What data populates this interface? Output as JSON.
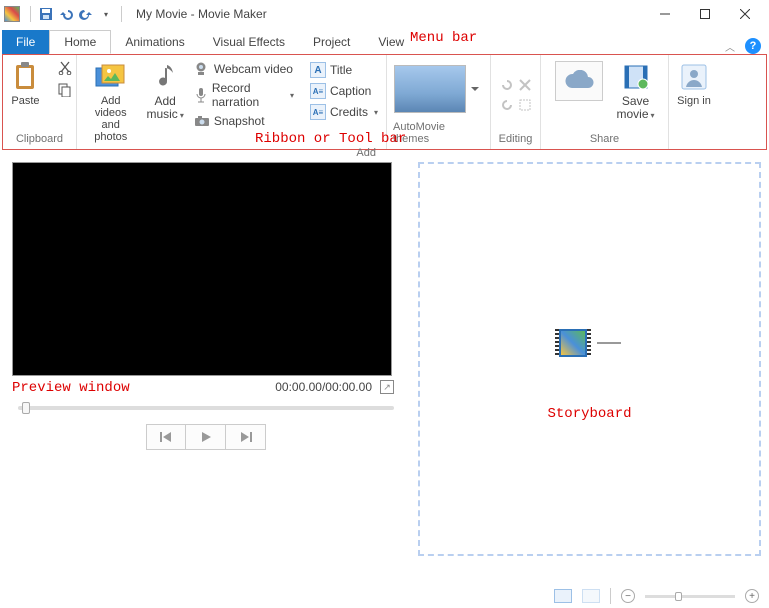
{
  "title": "My Movie - Movie Maker",
  "qat": {
    "undo_tip": "Undo",
    "redo_tip": "Redo",
    "save_tip": "Save"
  },
  "tabs": {
    "file": "File",
    "items": [
      "Home",
      "Animations",
      "Visual Effects",
      "Project",
      "View"
    ],
    "active": "Home"
  },
  "annotations": {
    "menu_bar": "Menu bar",
    "ribbon": "Ribbon or Tool bar",
    "preview": "Preview window",
    "storyboard": "Storyboard"
  },
  "ribbon": {
    "clipboard": {
      "label": "Clipboard",
      "paste": "Paste"
    },
    "add": {
      "label": "Add",
      "add_videos": "Add videos and photos",
      "add_music": "Add music",
      "webcam": "Webcam video",
      "record": "Record narration",
      "snapshot": "Snapshot",
      "title_btn": "Title",
      "caption": "Caption",
      "credits": "Credits"
    },
    "automovie": {
      "label": "AutoMovie themes"
    },
    "editing": {
      "label": "Editing"
    },
    "share": {
      "label": "Share",
      "save_movie": "Save movie"
    },
    "signin": {
      "label": "Sign in"
    }
  },
  "preview": {
    "time": "00:00.00/00:00.00"
  },
  "status": {
    "zoom_minus": "−",
    "zoom_plus": "+"
  }
}
